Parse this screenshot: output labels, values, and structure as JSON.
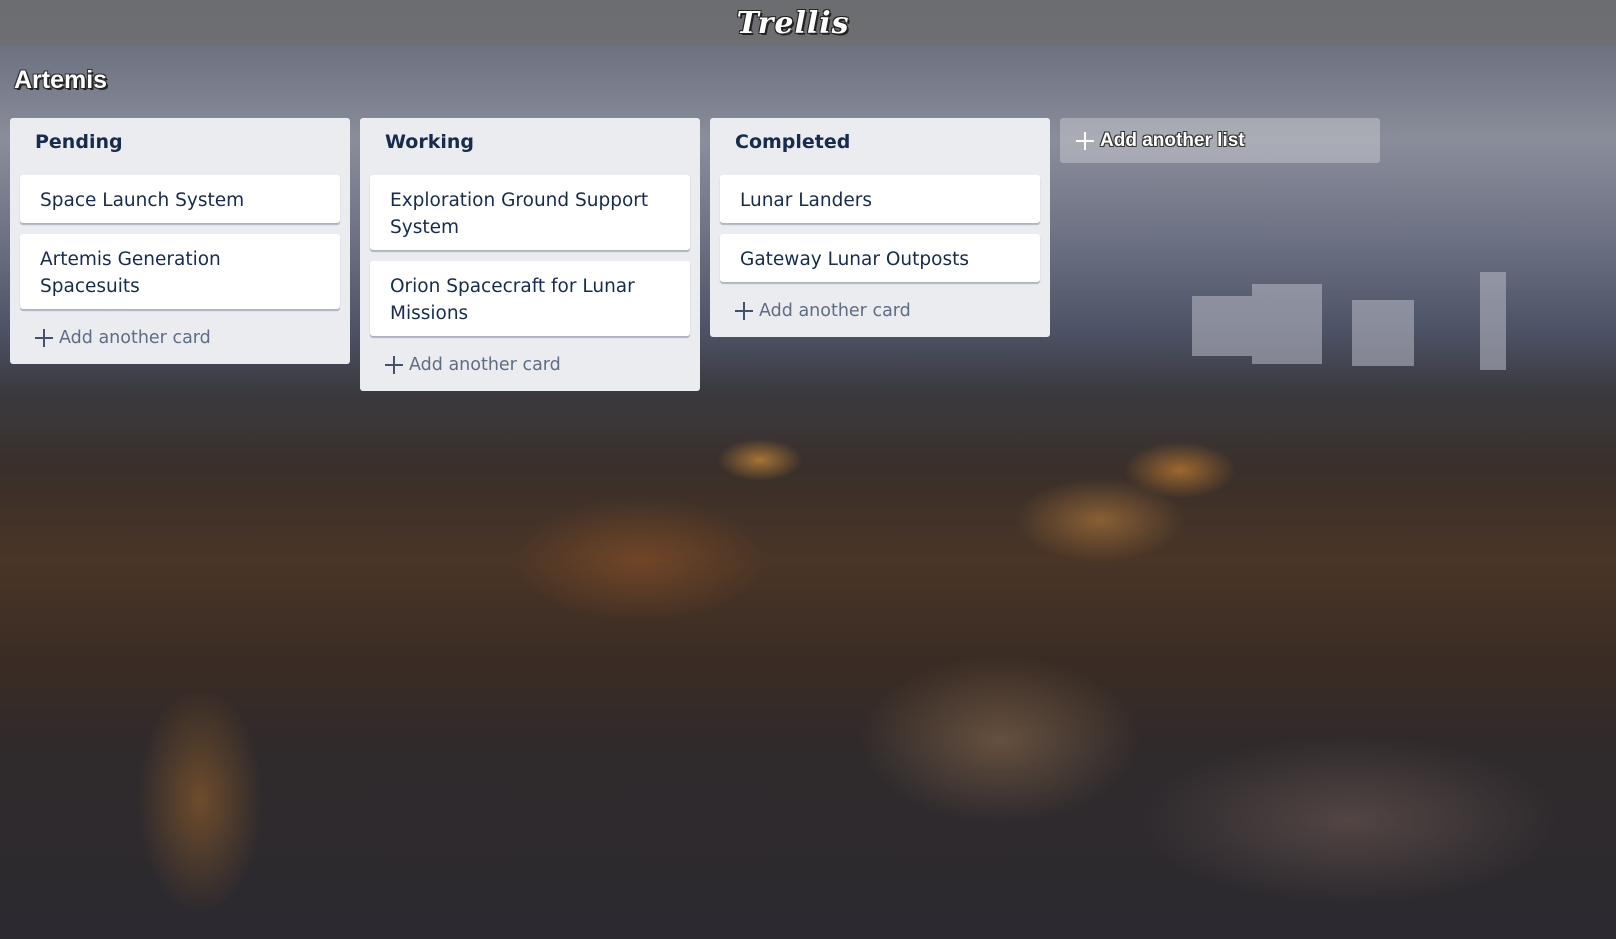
{
  "app": {
    "logo_text": "Trellis"
  },
  "board": {
    "title": "Artemis"
  },
  "lists": [
    {
      "title": "Pending",
      "cards": [
        "Space Launch System",
        "Artemis Generation Spacesuits"
      ],
      "add_card_label": "Add another card"
    },
    {
      "title": "Working",
      "cards": [
        "Exploration Ground Support System",
        "Orion Spacecraft for Lunar Missions"
      ],
      "add_card_label": "Add another card"
    },
    {
      "title": "Completed",
      "cards": [
        "Lunar Landers",
        "Gateway Lunar Outposts"
      ],
      "add_card_label": "Add another card"
    }
  ],
  "add_list": {
    "label": "Add another list",
    "icon": "plus-icon"
  },
  "colors": {
    "list_background": "#ebecf0",
    "card_background": "#ffffff",
    "header_bar": "#6e6e70",
    "text_primary": "#172b4d",
    "text_muted": "#5e6c84"
  }
}
